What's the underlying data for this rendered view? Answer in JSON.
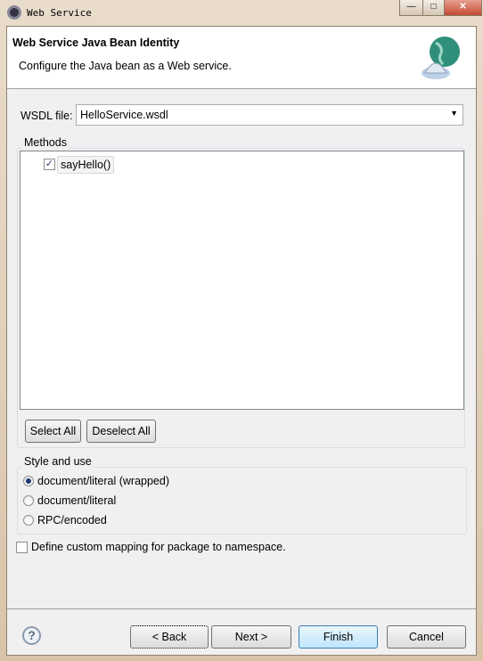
{
  "window": {
    "title": "Web Service",
    "controls": [
      "minimize",
      "maximize",
      "close"
    ]
  },
  "header": {
    "title": "Web Service Java Bean Identity",
    "description": "Configure the Java bean as a Web service.",
    "icon": "web-service-globe-icon"
  },
  "wsdl": {
    "label": "WSDL file:",
    "value": "HelloService.wsdl"
  },
  "methods": {
    "label": "Methods",
    "items": [
      {
        "label": "sayHello()",
        "checked": true
      }
    ],
    "select_all": "Select All",
    "deselect_all": "Deselect All"
  },
  "style": {
    "label": "Style and use",
    "options": [
      {
        "label": "document/literal (wrapped)",
        "selected": true
      },
      {
        "label": "document/literal",
        "selected": false
      },
      {
        "label": "RPC/encoded",
        "selected": false
      }
    ]
  },
  "custom_mapping": {
    "label": "Define custom mapping for package to namespace.",
    "checked": false
  },
  "footer": {
    "back": "< Back",
    "back_key": "B",
    "next": "Next >",
    "finish": "Finish",
    "cancel": "Cancel"
  }
}
